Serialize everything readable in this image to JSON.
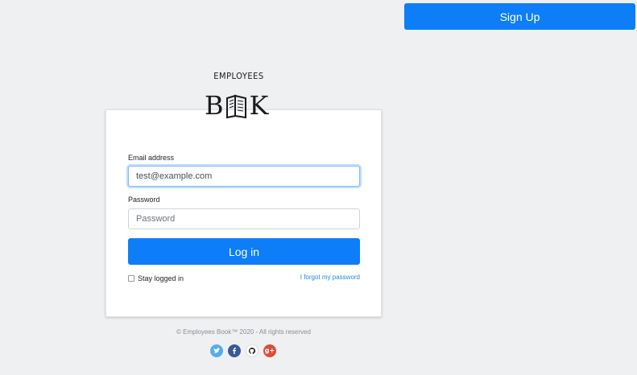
{
  "header": {
    "signup_label": "Sign Up"
  },
  "brand": {
    "top_text": "EMPLOYEES",
    "logo_text_left": "B",
    "logo_text_right": "K"
  },
  "login_form": {
    "email_label": "Email address",
    "email_value": "test@example.com",
    "password_label": "Password",
    "password_placeholder": "Password",
    "login_label": "Log in",
    "remember_label": "Stay logged in",
    "forgot_label": "I forgot my password"
  },
  "footer": {
    "copyright": "© Employees Book™ 2020 - All rights reserved"
  },
  "social": [
    {
      "name": "twitter-icon",
      "color": "#55acee",
      "glyph": "t"
    },
    {
      "name": "facebook-icon",
      "color": "#3b5998",
      "glyph": "f"
    },
    {
      "name": "github-icon",
      "color": "#ffffff",
      "glyph": "◉"
    },
    {
      "name": "google-plus-icon",
      "color": "#dd4b39",
      "glyph": "g+"
    }
  ],
  "colors": {
    "primary": "#0d7ef7",
    "background": "#eef0f2",
    "link": "#1a8ad6"
  }
}
